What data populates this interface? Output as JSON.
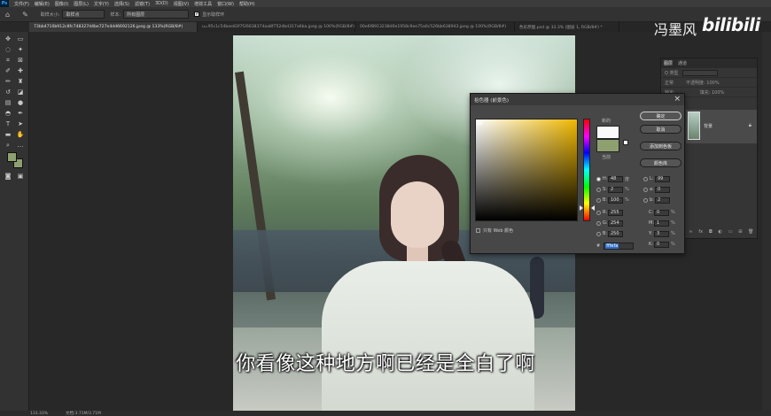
{
  "app": {
    "logo": "Ps"
  },
  "menu": [
    "文件(F)",
    "编辑(E)",
    "图像(I)",
    "图层(L)",
    "文字(Y)",
    "选择(S)",
    "滤镜(T)",
    "3D(D)",
    "视图(V)",
    "增效工具",
    "窗口(W)",
    "帮助(H)"
  ],
  "options": {
    "sample_size_label": "取样大小:",
    "sample_size_value": "取样点",
    "sample_label": "样本:",
    "sample_value": "所有图层",
    "show_ring_label": "显示取样环"
  },
  "tabs": [
    {
      "label": "73bb4710b912c8fc748327d4be727e4dd6692126.jpeg @ 133%(RGB/8#)",
      "active": true
    },
    {
      "label": "u=95c1c54bee83f7f26638374aa8f752dbd317a6ba.jpeg @ 100%(RGB/8#)",
      "active": false
    },
    {
      "label": "00e6f8913238d0e1958c9ee75a0c526bb638943.jpeg @ 100%(RGB/8#)",
      "active": false
    },
    {
      "label": "色彩原图.psd @ 33.3% (图层 1, RGB/8#) *",
      "active": false
    }
  ],
  "watermark": {
    "text": "冯墨风",
    "logo": "bilibili"
  },
  "layers_panel": {
    "tabs": [
      "图层",
      "通道"
    ],
    "filter_label": "Q 类型",
    "mode_label": "正常",
    "opacity_label": "不透明度: 100%",
    "lock_label": "锁定:",
    "fill_label": "填充: 100%",
    "layer_name": "背景"
  },
  "color_picker": {
    "title": "拾色器 (前景色)",
    "new_label": "新的",
    "current_label": "当前",
    "buttons": {
      "ok": "确定",
      "cancel": "取消",
      "add_swatch": "添加到色板",
      "libraries": "颜色库"
    },
    "only_web_label": "只有 Web 颜色",
    "values": {
      "H": "48",
      "S": "2",
      "B": "100",
      "R": "255",
      "G": "254",
      "Bl": "250",
      "L": "99",
      "a": "0",
      "b": "2",
      "C": "0",
      "M": "1",
      "Y": "3",
      "K": "0"
    },
    "units": {
      "deg": "度",
      "pct": "%"
    },
    "hex": "fffefa",
    "new_color": "#fafafa",
    "current_color": "#8fa070"
  },
  "subtitle": "你看像这种地方啊已经是全白了啊",
  "status": {
    "zoom": "133.33%",
    "doc": "文档:3.71M/3.71M"
  }
}
